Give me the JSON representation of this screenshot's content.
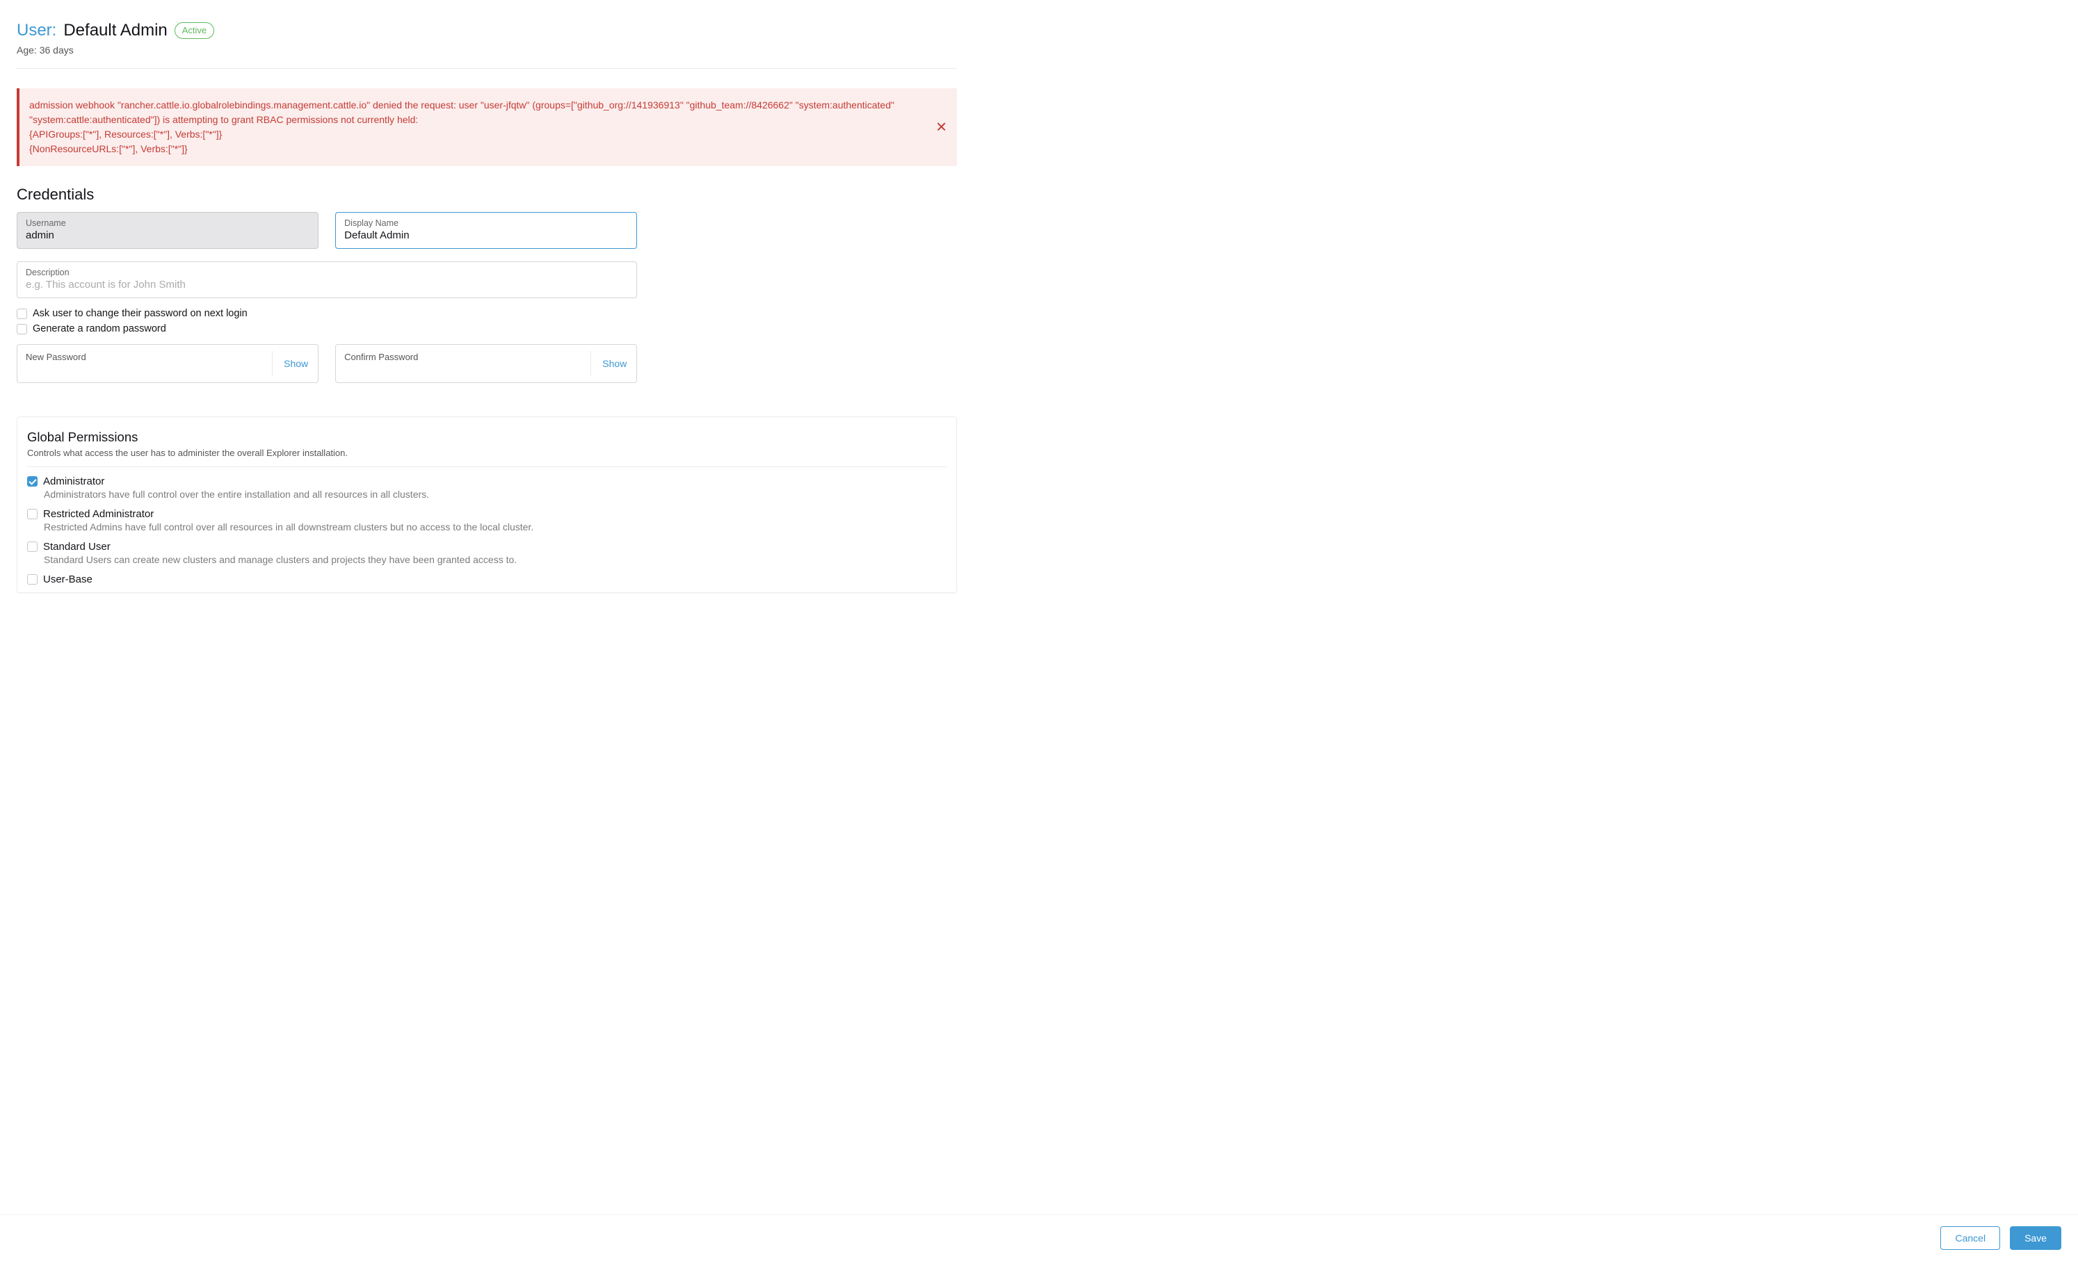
{
  "header": {
    "prefix": "User:",
    "name": "Default Admin",
    "status": "Active",
    "age_label": "Age:",
    "age_value": "36 days"
  },
  "alert": {
    "line1": "admission webhook \"rancher.cattle.io.globalrolebindings.management.cattle.io\" denied the request: user \"user-jfqtw\" (groups=[\"github_org://141936913\" \"github_team://8426662\" \"system:authenticated\" \"system:cattle:authenticated\"]) is attempting to grant RBAC permissions not currently held:",
    "line2": "{APIGroups:[\"*\"], Resources:[\"*\"], Verbs:[\"*\"]}",
    "line3": "{NonResourceURLs:[\"*\"], Verbs:[\"*\"]}"
  },
  "credentials": {
    "heading": "Credentials",
    "username_label": "Username",
    "username_value": "admin",
    "displayname_label": "Display Name",
    "displayname_value": "Default Admin",
    "description_label": "Description",
    "description_placeholder": "e.g. This account is for John Smith",
    "description_value": "",
    "chk_change_label": "Ask user to change their password on next login",
    "chk_change_checked": false,
    "chk_random_label": "Generate a random password",
    "chk_random_checked": false,
    "newpw_label": "New Password",
    "confirmpw_label": "Confirm Password",
    "show_label": "Show"
  },
  "permissions": {
    "heading": "Global Permissions",
    "sub": "Controls what access the user has to administer the overall Explorer installation.",
    "items": [
      {
        "title": "Administrator",
        "desc": "Administrators have full control over the entire installation and all resources in all clusters.",
        "checked": true
      },
      {
        "title": "Restricted Administrator",
        "desc": "Restricted Admins have full control over all resources in all downstream clusters but no access to the local cluster.",
        "checked": false
      },
      {
        "title": "Standard User",
        "desc": "Standard Users can create new clusters and manage clusters and projects they have been granted access to.",
        "checked": false
      },
      {
        "title": "User-Base",
        "desc": "",
        "checked": false
      }
    ]
  },
  "footer": {
    "cancel": "Cancel",
    "save": "Save"
  }
}
